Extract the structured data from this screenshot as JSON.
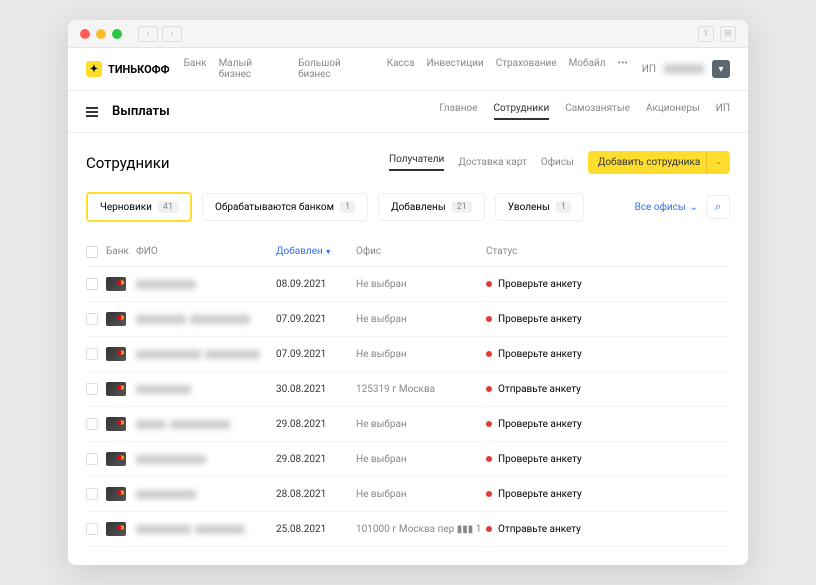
{
  "brand": "ТИНЬКОФФ",
  "topnav": [
    "Банк",
    "Малый бизнес",
    "Большой бизнес",
    "Касса",
    "Инвестиции",
    "Страхование",
    "Мобайл",
    "•••"
  ],
  "account_prefix": "ИП",
  "page": "Выплаты",
  "tabs": [
    "Главное",
    "Сотрудники",
    "Самозанятые",
    "Акционеры",
    "ИП"
  ],
  "tabs_active": "Сотрудники",
  "section": "Сотрудники",
  "subtabs": [
    "Получатели",
    "Доставка карт",
    "Офисы"
  ],
  "subtabs_active": "Получатели",
  "add_button": "Добавить сотрудника",
  "filters": [
    {
      "label": "Черновики",
      "count": "41",
      "active": true
    },
    {
      "label": "Обрабатываются банком",
      "count": "1"
    },
    {
      "label": "Добавлены",
      "count": "21"
    },
    {
      "label": "Уволены",
      "count": "1"
    }
  ],
  "office_filter": "Все офисы",
  "columns": {
    "bank": "Банк",
    "name": "ФИО",
    "date": "Добавлен",
    "office": "Офис",
    "status": "Статус"
  },
  "rows": [
    {
      "date": "08.09.2021",
      "office": "Не выбран",
      "status": "Проверьте анкету",
      "w1": 60,
      "w2": 0
    },
    {
      "date": "07.09.2021",
      "office": "Не выбран",
      "status": "Проверьте анкету",
      "w1": 50,
      "w2": 60
    },
    {
      "date": "07.09.2021",
      "office": "Не выбран",
      "status": "Проверьте анкету",
      "w1": 65,
      "w2": 55
    },
    {
      "date": "30.08.2021",
      "office": "125319 г Москва",
      "status": "Отправьте анкету",
      "w1": 55,
      "w2": 0
    },
    {
      "date": "29.08.2021",
      "office": "Не выбран",
      "status": "Проверьте анкету",
      "w1": 30,
      "w2": 60
    },
    {
      "date": "29.08.2021",
      "office": "Не выбран",
      "status": "Проверьте анкету",
      "w1": 70,
      "w2": 0
    },
    {
      "date": "28.08.2021",
      "office": "Не выбран",
      "status": "Проверьте анкету",
      "w1": 60,
      "w2": 0
    },
    {
      "date": "25.08.2021",
      "office": "101000 г Москва пер ▮▮▮ 1",
      "status": "Отправьте анкету",
      "w1": 55,
      "w2": 50
    }
  ]
}
